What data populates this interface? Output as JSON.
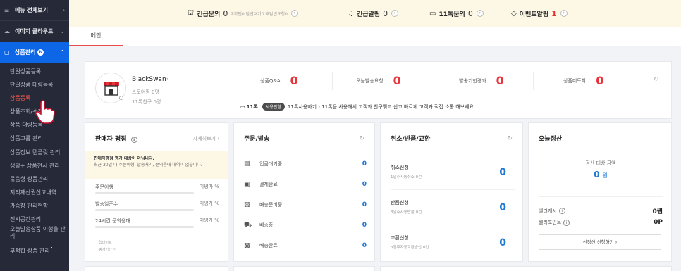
{
  "sidebar": {
    "menu_all": "메뉴 전체보기",
    "image_cloud": "이미지 클라우드",
    "product_mgmt": "상품관리",
    "product_badge": "N",
    "items": [
      {
        "label": "단일상품등록",
        "selected": false
      },
      {
        "label": "단일상품 대량등록",
        "selected": false
      },
      {
        "label": "상품등록",
        "selected": true
      },
      {
        "label": "상품조회/수정",
        "selected": false
      },
      {
        "label": "상품 대량등록",
        "selected": false
      },
      {
        "label": "상품그룹 관리",
        "selected": false
      },
      {
        "label": "상품정보 템플릿 관리",
        "selected": false
      },
      {
        "label": "생활+ 상품전시 관리",
        "selected": false
      },
      {
        "label": "묶음형 상품관리",
        "selected": false
      },
      {
        "label": "지적재산권신고내역",
        "selected": false
      },
      {
        "label": "가승장 관리현황",
        "selected": false
      },
      {
        "label": "전시공간관리",
        "selected": false
      },
      {
        "label": "오늘발송상품 이행율 관리",
        "selected": false
      },
      {
        "label": "부적합 상품 관리",
        "selected": false
      }
    ]
  },
  "topbar": {
    "urgent_inquiry": {
      "title": "긴급문의",
      "count": "0",
      "sub": "미확인0 답변대기0 재답변요청0"
    },
    "urgent_alert": {
      "title": "긴급알림",
      "count": "0"
    },
    "talk_inquiry": {
      "title": "11톡문의",
      "count": "0"
    },
    "event_alert": {
      "title": "이벤트알림",
      "count": "1"
    }
  },
  "tabs": {
    "main": "메인"
  },
  "store": {
    "name": "BlackSwan",
    "store_likes": "스토어찜 0명",
    "talk_friends": "11톡친구 0명",
    "stats": [
      {
        "label": "상품Q&A",
        "value": "0"
      },
      {
        "label": "오늘발송요청",
        "value": "0"
      },
      {
        "label": "발송기한경과",
        "value": "0"
      },
      {
        "label": "상품미도착",
        "value": "0"
      }
    ],
    "notice": {
      "prefix": "11톡",
      "pill": "사용안함",
      "link": "11톡사용하기",
      "text": "11톡을 사용해서 고객과 친구맺고 쉽고 빠르게 고객과 직접 소통 해보세요."
    }
  },
  "rating": {
    "title": "판매자 평점",
    "detail": "자세히보기",
    "warn_title": "판매자평점 평가 대상이 아닙니다.",
    "warn_body": "최근 30일 내 주문이행, 발송처리, 문의응대 내역이 없습니다.",
    "rows": [
      {
        "label": "주문이행",
        "value": "미평가 %"
      },
      {
        "label": "발송일준수",
        "value": "미평가 %"
      },
      {
        "label": "24시간 문의응대",
        "value": "미평가 %"
      }
    ],
    "foot1": "· 업데이트",
    "foot2": "· 평가기간 ~"
  },
  "order": {
    "title": "주문/발송",
    "rows": [
      {
        "label": "입금대기중",
        "value": "0",
        "icon": "card-icon"
      },
      {
        "label": "결제완료",
        "value": "0",
        "icon": "payment-icon"
      },
      {
        "label": "배송준비중",
        "value": "0",
        "icon": "box-icon"
      },
      {
        "label": "배송중",
        "value": "0",
        "icon": "truck-icon"
      },
      {
        "label": "배송완료",
        "value": "0",
        "icon": "done-icon"
      }
    ]
  },
  "cancel": {
    "title": "취소/반품/교환",
    "rows": [
      {
        "title": "취소신청",
        "sub": "1일후자동취소 0건",
        "value": "0"
      },
      {
        "title": "반품신청",
        "sub": "3일후자동반품 0건",
        "value": "0"
      },
      {
        "title": "교환신청",
        "sub": "3일후자동교환승인 0건",
        "value": "0"
      }
    ]
  },
  "settle": {
    "title": "오늘정산",
    "target_label": "정산 대상 금액",
    "target_value": "0",
    "target_unit": "원",
    "cash_label": "셀러캐시",
    "cash_value": "0원",
    "point_label": "셀러포인트",
    "point_value": "0P",
    "button": "선정산 신청하기"
  },
  "colors": {
    "accent": "#0d66e6",
    "red": "#e8333a",
    "blue": "#1f78d1",
    "sidebar": "#252938"
  }
}
